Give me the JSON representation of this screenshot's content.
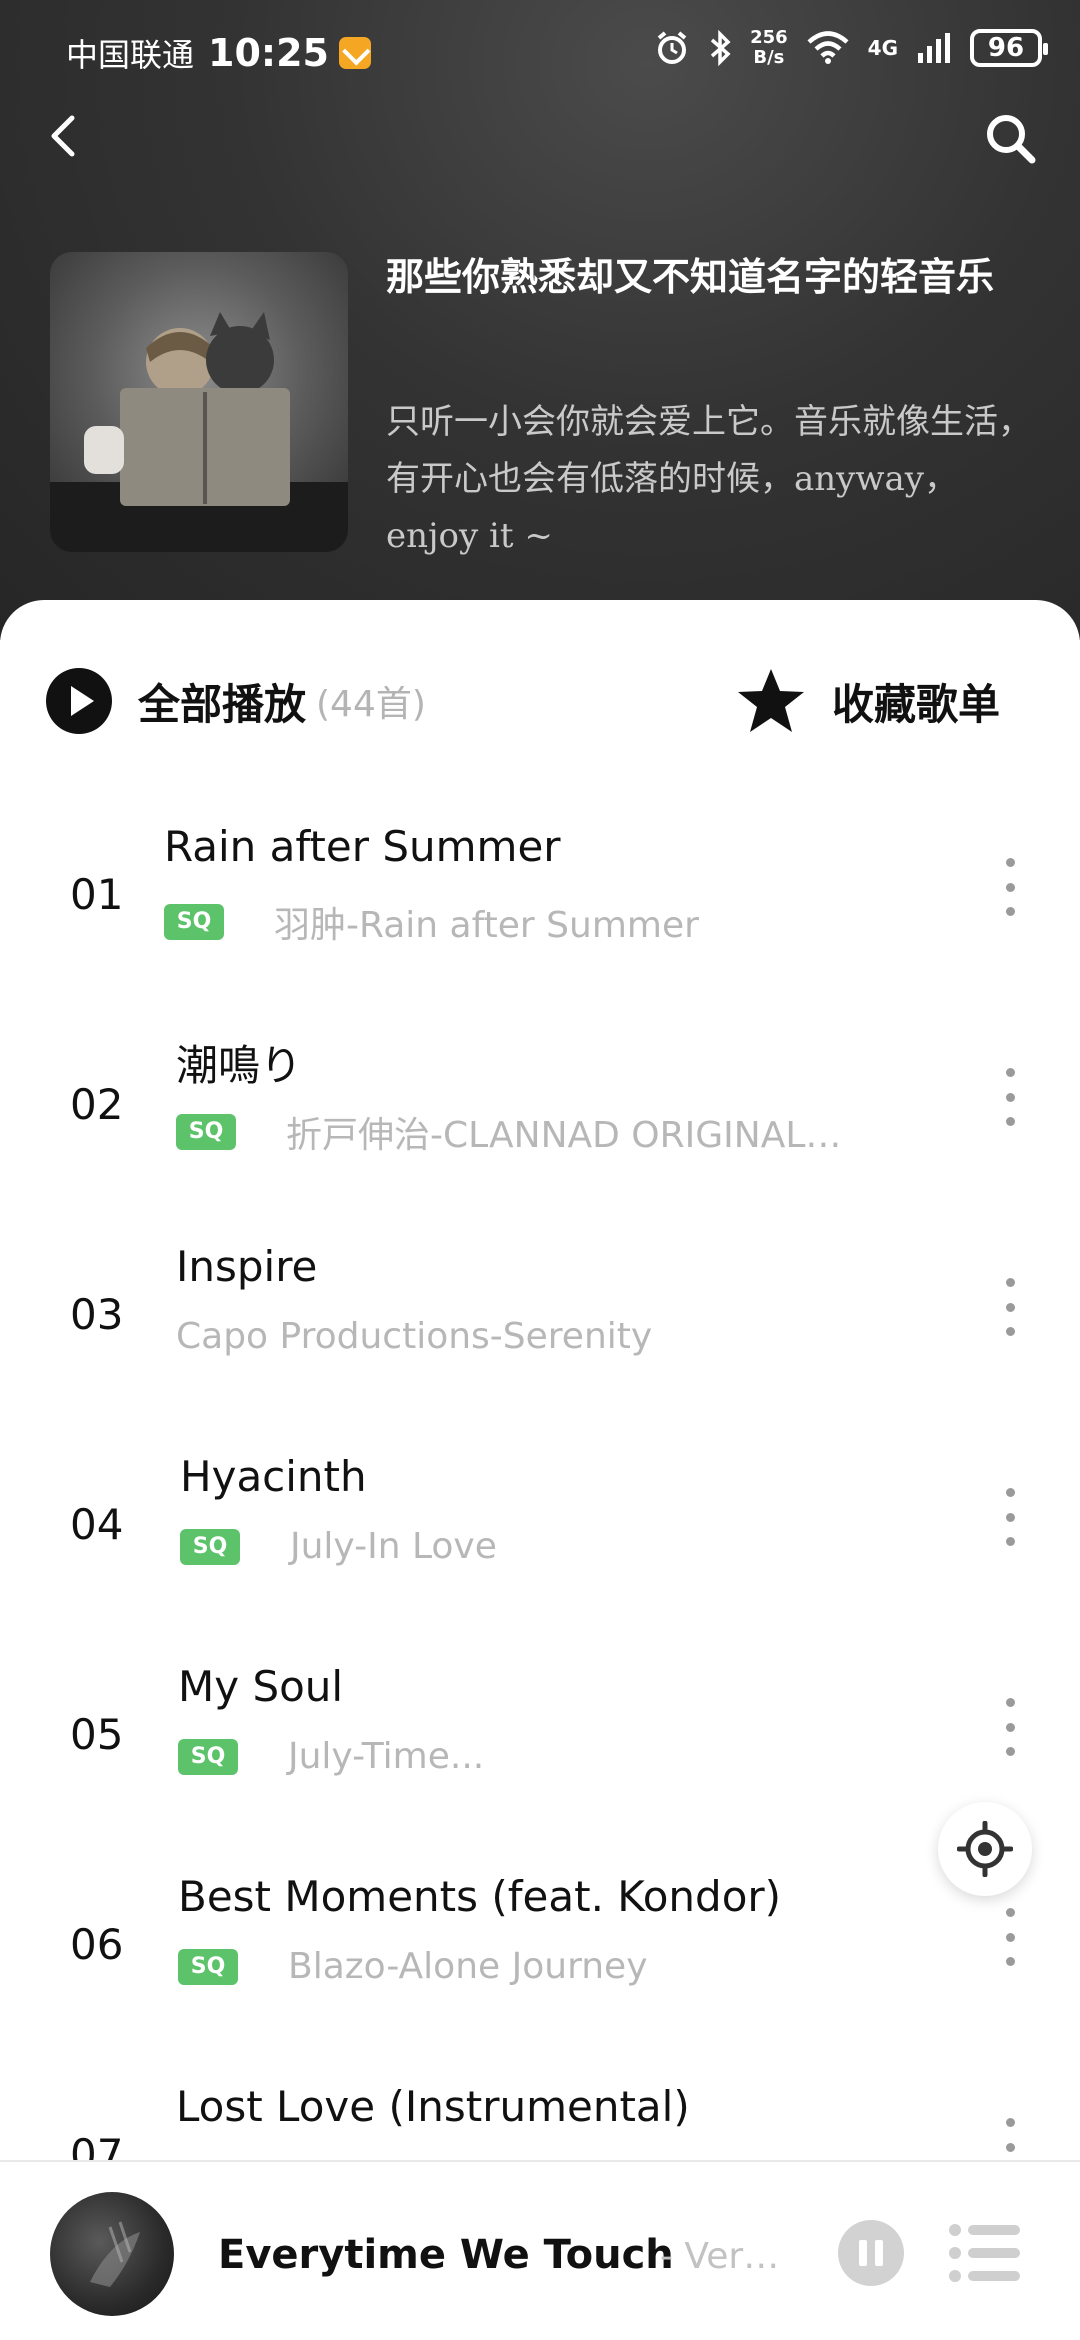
{
  "status_bar": {
    "carrier": "中国联通",
    "time": "10:25",
    "net_speed_value": "256",
    "net_speed_unit": "B/s",
    "network": "4G",
    "battery": "96"
  },
  "playlist": {
    "title": "那些你熟悉却又不知道名字的轻音乐",
    "description": "只听一小会你就会爱上它。音乐就像生活，有开心也会有低落的时候，anyway，enjoy it ~"
  },
  "actions": {
    "play_all_label": "全部播放",
    "play_all_count": "(44首)",
    "favorite_label": "收藏歌单"
  },
  "tracks": [
    {
      "num": "01",
      "title": "Rain after Summer",
      "badge": "SQ",
      "artist": "羽肿-Rain after Summer"
    },
    {
      "num": "02",
      "title": "潮鳴り",
      "badge": "SQ",
      "artist": "折戸伸治-CLANNAD ORIGINAL…"
    },
    {
      "num": "03",
      "title": "Inspire",
      "badge": "",
      "artist": "Capo Productions-Serenity"
    },
    {
      "num": "04",
      "title": "Hyacinth",
      "badge": "SQ",
      "artist": "July-In Love"
    },
    {
      "num": "05",
      "title": "My Soul",
      "badge": "SQ",
      "artist": "July-Time..."
    },
    {
      "num": "06",
      "title": "Best Moments (feat. Kondor)",
      "badge": "SQ",
      "artist": "Blazo-Alone Journey"
    },
    {
      "num": "07",
      "title": "Lost Love (Instrumental)",
      "badge": "",
      "artist": ""
    }
  ],
  "mini_player": {
    "title": "Everytime We Touch",
    "subtitle": "- Ver…"
  },
  "colors": {
    "sq_badge": "#5cc36a",
    "header_bg": "#333333",
    "muted_text": "#b7b7b7"
  },
  "icons": {
    "back": "chevron-left-icon",
    "search": "search-icon",
    "play_all": "play-circle-icon",
    "favorite": "star-icon",
    "more": "more-vertical-icon",
    "locate": "locate-icon",
    "pause": "pause-icon",
    "queue": "playlist-queue-icon"
  }
}
